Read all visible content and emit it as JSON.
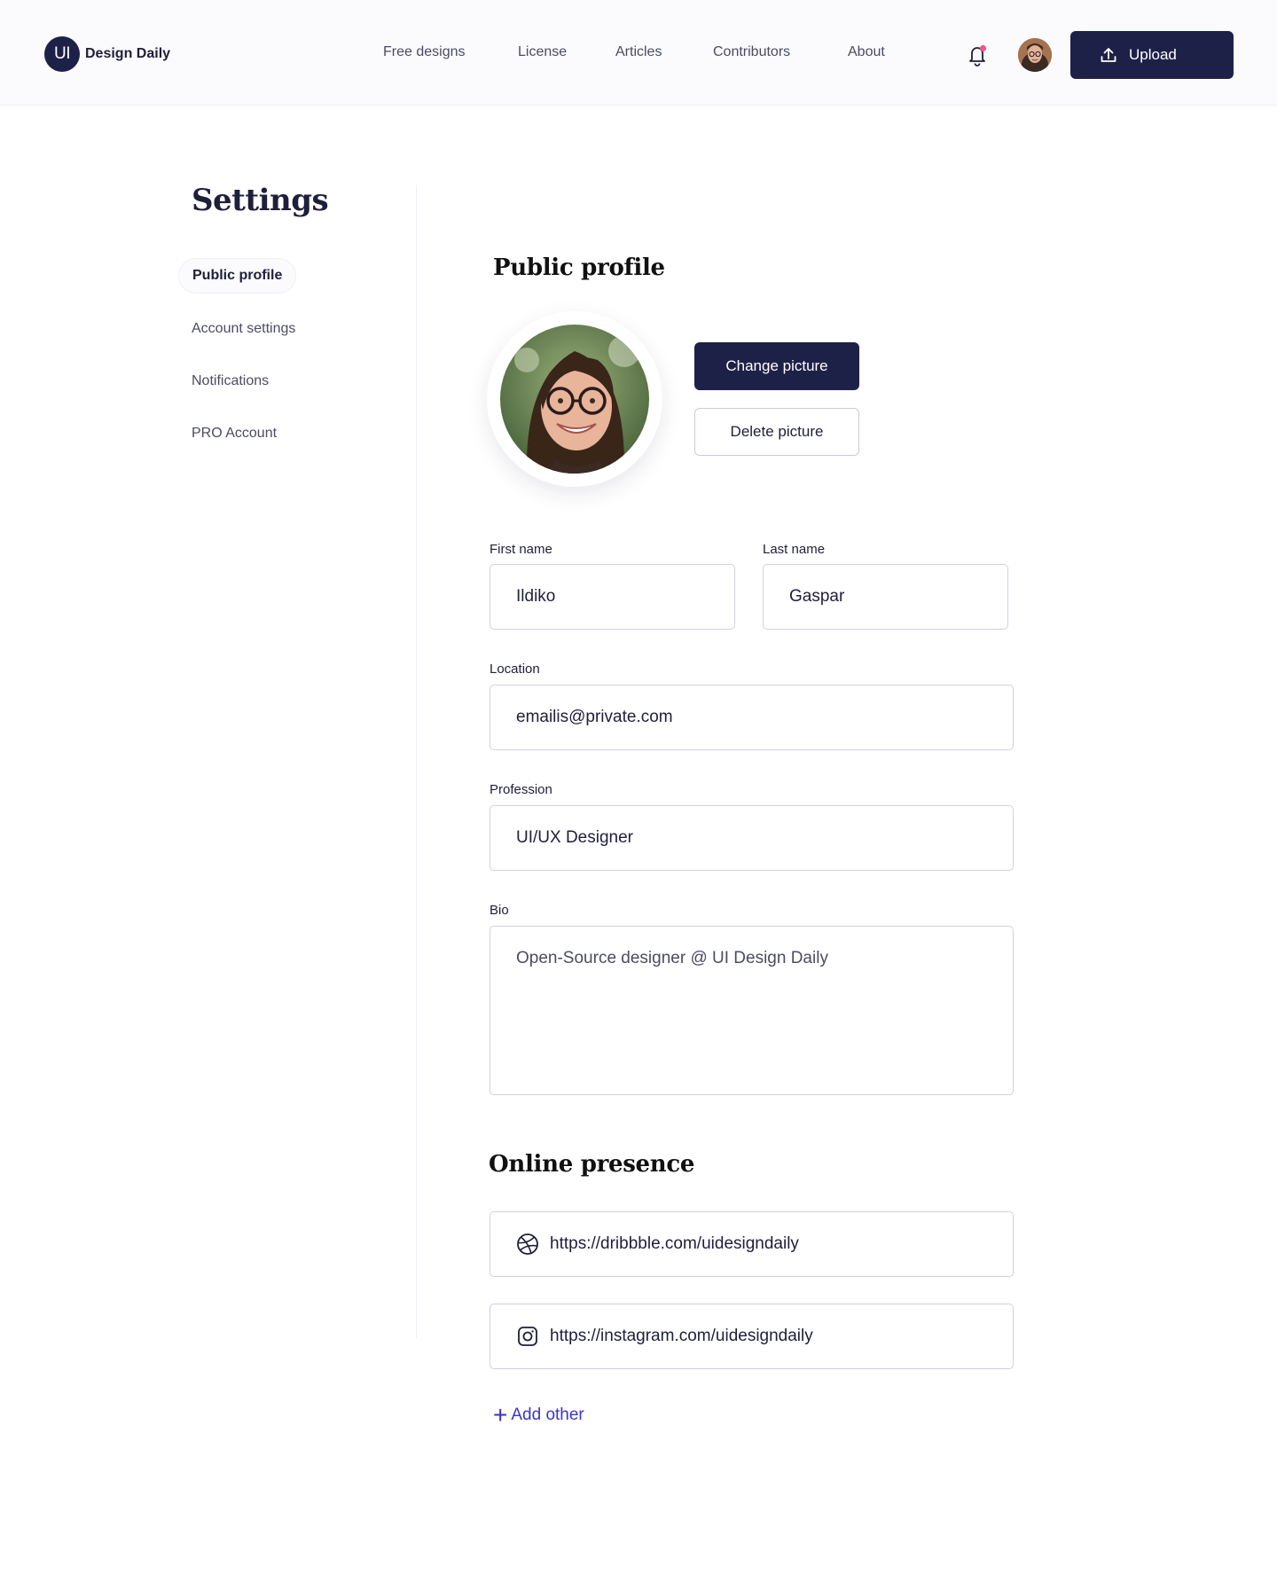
{
  "header": {
    "logo_badge": "UI",
    "logo_text": "Design Daily",
    "nav": [
      "Free designs",
      "License",
      "Articles",
      "Contributors",
      "About"
    ],
    "upload_label": "Upload",
    "notification_dot_color": "#f0568a"
  },
  "sidebar": {
    "title": "Settings",
    "items": [
      {
        "label": "Public profile",
        "active": true
      },
      {
        "label": "Account settings",
        "active": false
      },
      {
        "label": "Notifications",
        "active": false
      },
      {
        "label": "PRO Account",
        "active": false
      }
    ]
  },
  "profile": {
    "title": "Public profile",
    "change_picture": "Change picture",
    "delete_picture": "Delete picture",
    "fields": {
      "first_name": {
        "label": "First name",
        "value": "Ildiko"
      },
      "last_name": {
        "label": "Last name",
        "value": "Gaspar"
      },
      "location": {
        "label": "Location",
        "value": "emailis@private.com"
      },
      "profession": {
        "label": "Profession",
        "value": "UI/UX Designer"
      },
      "bio": {
        "label": "Bio",
        "value": "Open-Source designer @ UI Design Daily"
      }
    }
  },
  "online_presence": {
    "title": "Online presence",
    "links": [
      {
        "icon": "dribbble-icon",
        "value": "https://dribbble.com/uidesigndaily"
      },
      {
        "icon": "instagram-icon",
        "value": "https://instagram.com/uidesigndaily"
      }
    ],
    "add_other": "Add other"
  },
  "colors": {
    "primary": "#1e2147",
    "accent_link": "#3a35c8",
    "border": "#cfd1e3"
  }
}
